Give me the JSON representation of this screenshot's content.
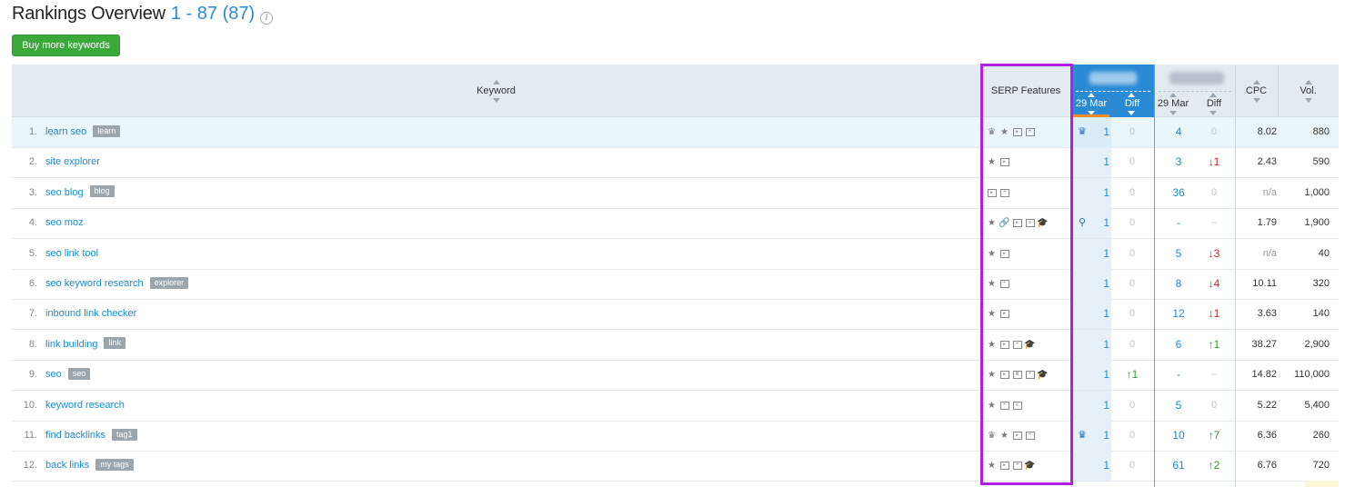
{
  "page": {
    "title": "Rankings Overview",
    "range": "1 - 87 (87)",
    "info_icon": "i",
    "buy_button": "Buy more keywords"
  },
  "columns": {
    "keyword": "Keyword",
    "serp_features": "SERP Features",
    "domain1_date": "29 Mar",
    "domain1_diff": "Diff",
    "domain2_date": "29 Mar",
    "domain2_diff": "Diff",
    "cpc": "CPC",
    "vol": "Vol."
  },
  "colors": {
    "accent": "#2a8ad4",
    "buy_button": "#3aa93a",
    "highlight_box": "#b01fe8",
    "up": "#2e9a2e",
    "down": "#d3201f"
  },
  "rows": [
    {
      "num": "1.",
      "keyword": "learn seo",
      "tag": "learn",
      "serp": [
        "crown",
        "star",
        "video",
        "review"
      ],
      "d1_icon": "crown",
      "d1_pos": "1",
      "d1_diff": "0",
      "d1_diff_dir": "none",
      "d2_pos": "4",
      "d2_diff": "0",
      "d2_diff_dir": "none",
      "cpc": "8.02",
      "vol": "880",
      "highlight": true
    },
    {
      "num": "2.",
      "keyword": "site explorer",
      "tag": "",
      "serp": [
        "star",
        "video"
      ],
      "d1_icon": "",
      "d1_pos": "1",
      "d1_diff": "0",
      "d1_diff_dir": "none",
      "d2_pos": "3",
      "d2_diff": "↓1",
      "d2_diff_dir": "down",
      "cpc": "2.43",
      "vol": "590"
    },
    {
      "num": "3.",
      "keyword": "seo blog",
      "tag": "blog",
      "serp": [
        "video",
        "review"
      ],
      "d1_icon": "",
      "d1_pos": "1",
      "d1_diff": "0",
      "d1_diff_dir": "none",
      "d2_pos": "36",
      "d2_diff": "0",
      "d2_diff_dir": "none",
      "cpc": "n/a",
      "vol": "1,000"
    },
    {
      "num": "4.",
      "keyword": "seo moz",
      "tag": "",
      "serp": [
        "star",
        "link",
        "video",
        "news",
        "edu"
      ],
      "d1_icon": "link",
      "d1_pos": "1",
      "d1_diff": "0",
      "d1_diff_dir": "none",
      "d2_pos": "-",
      "d2_diff": "–",
      "d2_diff_dir": "none",
      "cpc": "1.79",
      "vol": "1,900"
    },
    {
      "num": "5.",
      "keyword": "seo link tool",
      "tag": "",
      "serp": [
        "star",
        "video"
      ],
      "d1_icon": "",
      "d1_pos": "1",
      "d1_diff": "0",
      "d1_diff_dir": "none",
      "d2_pos": "5",
      "d2_diff": "↓3",
      "d2_diff_dir": "down",
      "cpc": "n/a",
      "vol": "40"
    },
    {
      "num": "6.",
      "keyword": "seo keyword research",
      "tag": "explorer",
      "serp": [
        "star",
        "review"
      ],
      "d1_icon": "",
      "d1_pos": "1",
      "d1_diff": "0",
      "d1_diff_dir": "none",
      "d2_pos": "8",
      "d2_diff": "↓4",
      "d2_diff_dir": "down",
      "cpc": "10.11",
      "vol": "320"
    },
    {
      "num": "7.",
      "keyword": "inbound link checker",
      "tag": "",
      "serp": [
        "star",
        "video"
      ],
      "d1_icon": "",
      "d1_pos": "1",
      "d1_diff": "0",
      "d1_diff_dir": "none",
      "d2_pos": "12",
      "d2_diff": "↓1",
      "d2_diff_dir": "down",
      "cpc": "3.63",
      "vol": "140"
    },
    {
      "num": "8.",
      "keyword": "link building",
      "tag": "link",
      "serp": [
        "star",
        "video",
        "review",
        "edu"
      ],
      "d1_icon": "",
      "d1_pos": "1",
      "d1_diff": "0",
      "d1_diff_dir": "none",
      "d2_pos": "6",
      "d2_diff": "↑1",
      "d2_diff_dir": "up",
      "cpc": "38.27",
      "vol": "2,900"
    },
    {
      "num": "9.",
      "keyword": "seo",
      "tag": "seo",
      "serp": [
        "star",
        "video",
        "doc",
        "review",
        "edu"
      ],
      "d1_icon": "",
      "d1_pos": "1",
      "d1_diff": "↑1",
      "d1_diff_dir": "up",
      "d2_pos": "-",
      "d2_diff": "–",
      "d2_diff_dir": "none",
      "cpc": "14.82",
      "vol": "110,000"
    },
    {
      "num": "10.",
      "keyword": "keyword research",
      "tag": "",
      "serp": [
        "star",
        "review",
        "news"
      ],
      "d1_icon": "",
      "d1_pos": "1",
      "d1_diff": "0",
      "d1_diff_dir": "none",
      "d2_pos": "5",
      "d2_diff": "0",
      "d2_diff_dir": "none",
      "cpc": "5.22",
      "vol": "5,400"
    },
    {
      "num": "11.",
      "keyword": "find backlinks",
      "tag": "tag1",
      "serp": [
        "crown",
        "star",
        "video",
        "review"
      ],
      "d1_icon": "crown",
      "d1_pos": "1",
      "d1_diff": "0",
      "d1_diff_dir": "none",
      "d2_pos": "10",
      "d2_diff": "↑7",
      "d2_diff_dir": "up",
      "cpc": "6.36",
      "vol": "260"
    },
    {
      "num": "12.",
      "keyword": "back links",
      "tag": "my tags",
      "serp": [
        "star",
        "video",
        "review",
        "edu"
      ],
      "d1_icon": "",
      "d1_pos": "1",
      "d1_diff": "0",
      "d1_diff_dir": "none",
      "d2_pos": "61",
      "d2_diff": "↑2",
      "d2_diff_dir": "up",
      "cpc": "6.76",
      "vol": "720"
    }
  ]
}
